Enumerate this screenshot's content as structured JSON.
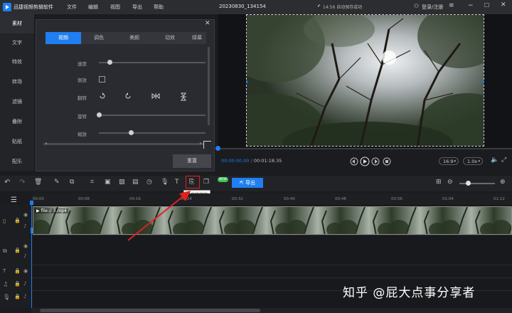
{
  "app": {
    "name": "迅捷视频剪辑软件",
    "menu": [
      "文件",
      "编辑",
      "视图",
      "导出",
      "帮助"
    ],
    "project_title": "20230830_134154",
    "autosave": "14:56 自动保存成功",
    "login": "登录/注册"
  },
  "sidebar": {
    "items": [
      {
        "label": "素材",
        "active": true
      },
      {
        "label": "文字",
        "active": false
      },
      {
        "label": "特效",
        "active": false
      },
      {
        "label": "转场",
        "active": false
      },
      {
        "label": "滤镜",
        "active": false
      },
      {
        "label": "叠附",
        "active": false
      },
      {
        "label": "贴纸",
        "active": false
      },
      {
        "label": "配乐",
        "active": false
      }
    ]
  },
  "panel": {
    "tabs": [
      {
        "label": "视频",
        "active": true
      },
      {
        "label": "调色",
        "active": false
      },
      {
        "label": "美颜",
        "active": false
      },
      {
        "label": "动效",
        "active": false
      },
      {
        "label": "绿幕",
        "active": false
      }
    ],
    "speed_label": "速度",
    "speed_value": 0.1,
    "reverse_label": "倒放",
    "flip_label": "翻转",
    "rotate_label": "旋转",
    "rotate_value": 0.0,
    "scale_label": "缩放",
    "scale_value": 0.3,
    "reset_label": "重置"
  },
  "player": {
    "current_time": "00:00:00.00",
    "separator": " / ",
    "total_time": "00:01:18.35",
    "aspect": "16:9",
    "speed": "1.0x"
  },
  "toolbar": {
    "new_badge": "NEW",
    "export_label": "导出",
    "tooltip": "语音转文字"
  },
  "timeline": {
    "ticks": [
      "00:00",
      "00:08",
      "00:16",
      "00:24",
      "00:32",
      "00:40",
      "00:48",
      "00:56",
      "01:04",
      "01:12"
    ],
    "clip_name": "file:// 3.mp4"
  },
  "watermark": "知乎 @屁大点事分享者",
  "colors": {
    "accent": "#1f7ef1",
    "highlight": "#e02020",
    "new_badge": "#3ec25a"
  }
}
